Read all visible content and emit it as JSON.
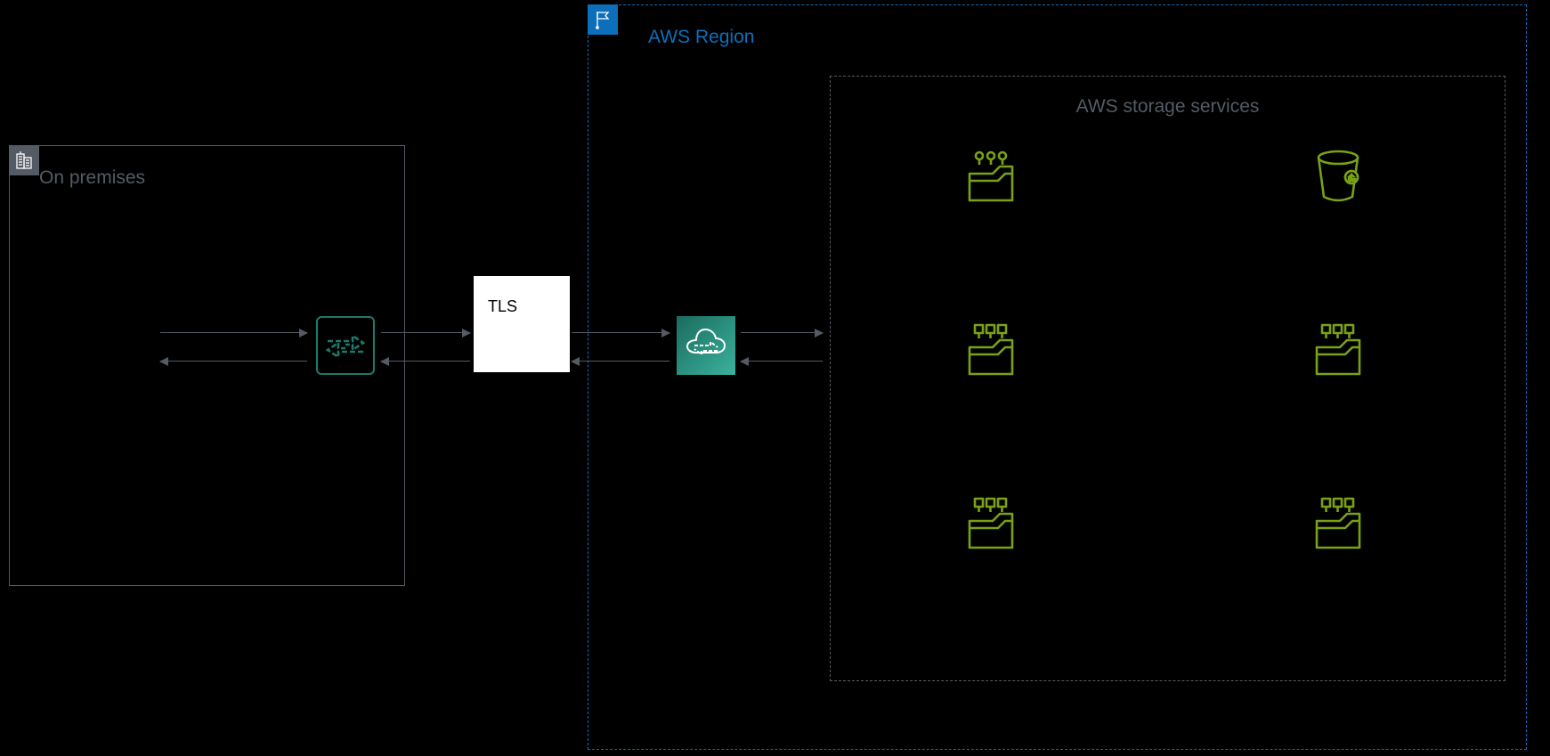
{
  "on_premises": {
    "label": "On premises"
  },
  "region": {
    "label": "AWS Region"
  },
  "storage_group": {
    "label": "AWS storage services"
  },
  "tls": {
    "label": "TLS"
  },
  "colors": {
    "region_border": "#0d6fba",
    "group_border": "#545b64",
    "arrow": "#545b64",
    "service_green": "#7aa116",
    "datasync_teal": "#1b7a6b"
  },
  "icons": {
    "onprem_badge": "building-icon",
    "region_badge": "flag-icon",
    "agent": "datasync-agent-icon",
    "service": "datasync-service-icon"
  },
  "storage_services": [
    {
      "id": "efs",
      "icon": "efs-icon",
      "row": 0,
      "col": 0
    },
    {
      "id": "s3",
      "icon": "s3-bucket-icon",
      "row": 0,
      "col": 1
    },
    {
      "id": "fsx-win",
      "icon": "fsx-icon",
      "row": 1,
      "col": 0
    },
    {
      "id": "fsx-lustre",
      "icon": "fsx-icon",
      "row": 1,
      "col": 1
    },
    {
      "id": "fsx-ontap",
      "icon": "fsx-icon",
      "row": 2,
      "col": 0
    },
    {
      "id": "fsx-openzfs",
      "icon": "fsx-icon",
      "row": 2,
      "col": 1
    }
  ]
}
